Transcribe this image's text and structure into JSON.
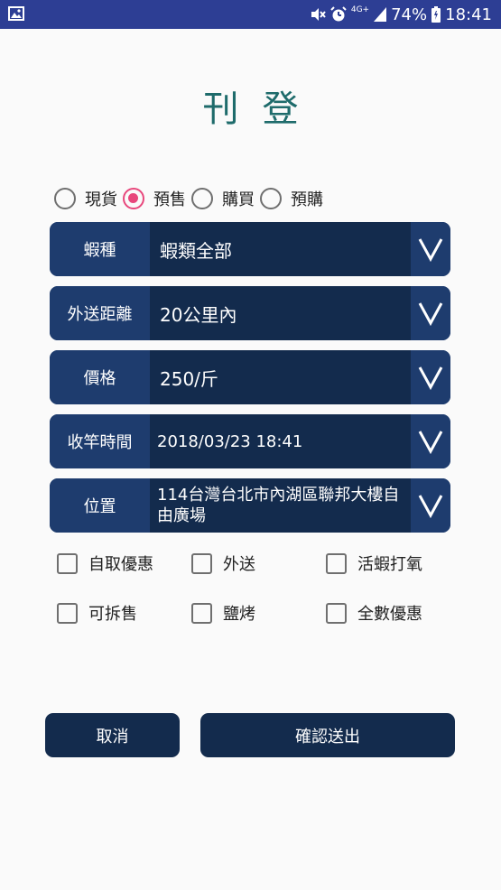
{
  "status_bar": {
    "battery_percent": "74%",
    "time": "18:41",
    "network_label": "4G+",
    "icons": [
      "image-icon",
      "mute-icon",
      "alarm-icon",
      "signal-icon",
      "battery-icon"
    ],
    "background_color": "#2d3e94"
  },
  "page": {
    "title": "刊登"
  },
  "sale_type": {
    "options": [
      {
        "label": "現貨",
        "checked": false
      },
      {
        "label": "預售",
        "checked": true
      },
      {
        "label": "購買",
        "checked": false
      },
      {
        "label": "預購",
        "checked": false
      }
    ],
    "checked_color": "#e8477c"
  },
  "fields": [
    {
      "label": "蝦種",
      "value": "蝦類全部"
    },
    {
      "label": "外送距離",
      "value": "20公里內"
    },
    {
      "label": "價格",
      "value": "250/斤"
    },
    {
      "label": "收竿時間",
      "value": "2018/03/23 18:41"
    },
    {
      "label": "位置",
      "value": "114台灣台北市內湖區聯邦大樓自由廣場"
    }
  ],
  "options": [
    {
      "label": "自取優惠",
      "checked": false
    },
    {
      "label": "外送",
      "checked": false
    },
    {
      "label": "活蝦打氧",
      "checked": false
    },
    {
      "label": "可拆售",
      "checked": false
    },
    {
      "label": "鹽烤",
      "checked": false
    },
    {
      "label": "全數優惠",
      "checked": false
    }
  ],
  "actions": {
    "cancel_label": "取消",
    "submit_label": "確認送出"
  },
  "colors": {
    "title": "#1e6b6b",
    "field_label_bg": "#1e3c6e",
    "field_value_bg": "#132b4d",
    "button_bg": "#132b4d"
  }
}
